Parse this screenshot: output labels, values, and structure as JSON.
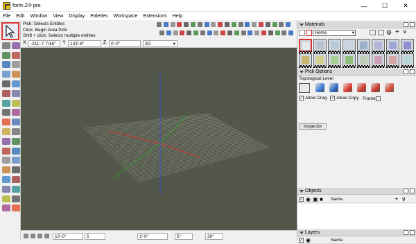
{
  "app": {
    "title": "form·Z® pro"
  },
  "menu": [
    "File",
    "Edit",
    "Window",
    "View",
    "Display",
    "Palettes",
    "Workspace",
    "Extensions",
    "Help"
  ],
  "prompt": {
    "line1": "Pick:   Selects Entities",
    "line2": "Click: Begin Area Pick",
    "line3": "Shift + click: Selects multiple entities"
  },
  "coords": {
    "x_label": "X",
    "x_value": "-211'-7 7/16\"",
    "y_label": "Y",
    "y_value": "133'-8\"",
    "z_label": "Z",
    "z_value": "0'-0\"",
    "view_mode": "3D"
  },
  "status": {
    "grid": "10'-0\"",
    "divisions": "5",
    "snap": "1'-0\"",
    "angle_step": "5°",
    "angle": "30°"
  },
  "materials": {
    "title": "Materials",
    "library": "Home",
    "swatch_colors": [
      "#e8e8e8",
      "#b9c2cc",
      "#b7c9d8",
      "#c7d3df",
      "#9ab0c8",
      "#b8b2d6",
      "#9ea7d4",
      "#8f8fcf",
      "#c9b56b",
      "#d2d28e",
      "#a7cf93",
      "#8fbf7a",
      "#bfcdb8",
      "#cba0bc",
      "#d6a7a7",
      "#b7d7d7"
    ]
  },
  "pick_options": {
    "title": "Pick Options",
    "topological_level": "Topological Level",
    "allow_drag": "Allow Drag",
    "allow_copy": "Allow Copy",
    "frame": "Frame",
    "inspector": "Inspector",
    "level_colors": [
      "#3c7bd5",
      "#2f67c4",
      "#e33b2a",
      "#cf3a2c",
      "#c63a2c",
      "#d94e3c"
    ]
  },
  "objects": {
    "title": "Objects",
    "name_col": "Name"
  },
  "layers": {
    "title": "Layers",
    "name_col": "Name"
  },
  "icons": [
    "pick-arrow-icon",
    "close-icon",
    "maximize-icon",
    "minimize-icon",
    "chevron-down-icon",
    "plus-icon",
    "gear-icon"
  ]
}
